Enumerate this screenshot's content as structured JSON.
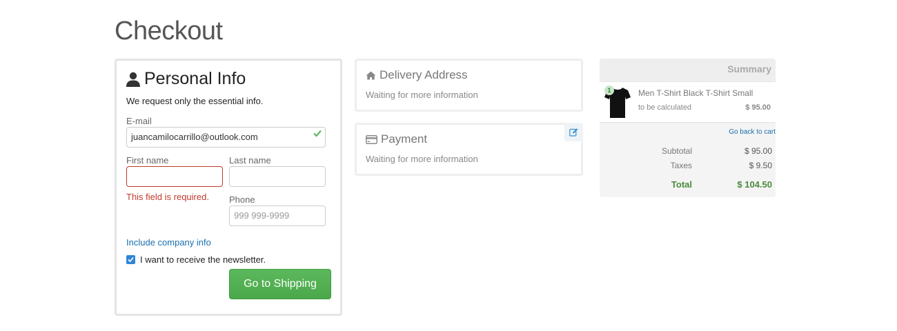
{
  "page": {
    "title": "Checkout"
  },
  "personal_info": {
    "title": "Personal Info",
    "intro": "We request only the essential info.",
    "email_label": "E-mail",
    "email_value": "juancamilocarrillo@outlook.com",
    "first_name_label": "First name",
    "first_name_value": "",
    "last_name_label": "Last name",
    "last_name_value": "",
    "first_name_error": "This field is required.",
    "phone_label": "Phone",
    "phone_placeholder": "999 999-9999",
    "company_link": "Include company info",
    "newsletter_label": "I want to receive the newsletter.",
    "newsletter_checked": true,
    "submit_label": "Go to Shipping"
  },
  "delivery": {
    "title": "Delivery Address",
    "status": "Waiting for more information"
  },
  "payment": {
    "title": "Payment",
    "status": "Waiting for more information"
  },
  "summary": {
    "title": "Summary",
    "items": [
      {
        "quantity": "1",
        "name": "Men T-Shirt Black T-Shirt Small",
        "shipping": "to be calculated",
        "price": "$ 95.00"
      }
    ],
    "back_to_cart": "Go back to cart",
    "subtotal_label": "Subtotal",
    "subtotal_value": "$ 95.00",
    "taxes_label": "Taxes",
    "taxes_value": "$ 9.50",
    "total_label": "Total",
    "total_value": "$ 104.50"
  },
  "colors": {
    "primary_button": "#5cb85c",
    "error": "#c0392b",
    "link": "#1a6fb0",
    "total": "#4a8a3c"
  },
  "icons": [
    "user-icon",
    "check-icon",
    "home-icon",
    "credit-card-icon",
    "edit-icon",
    "checkbox-icon"
  ]
}
